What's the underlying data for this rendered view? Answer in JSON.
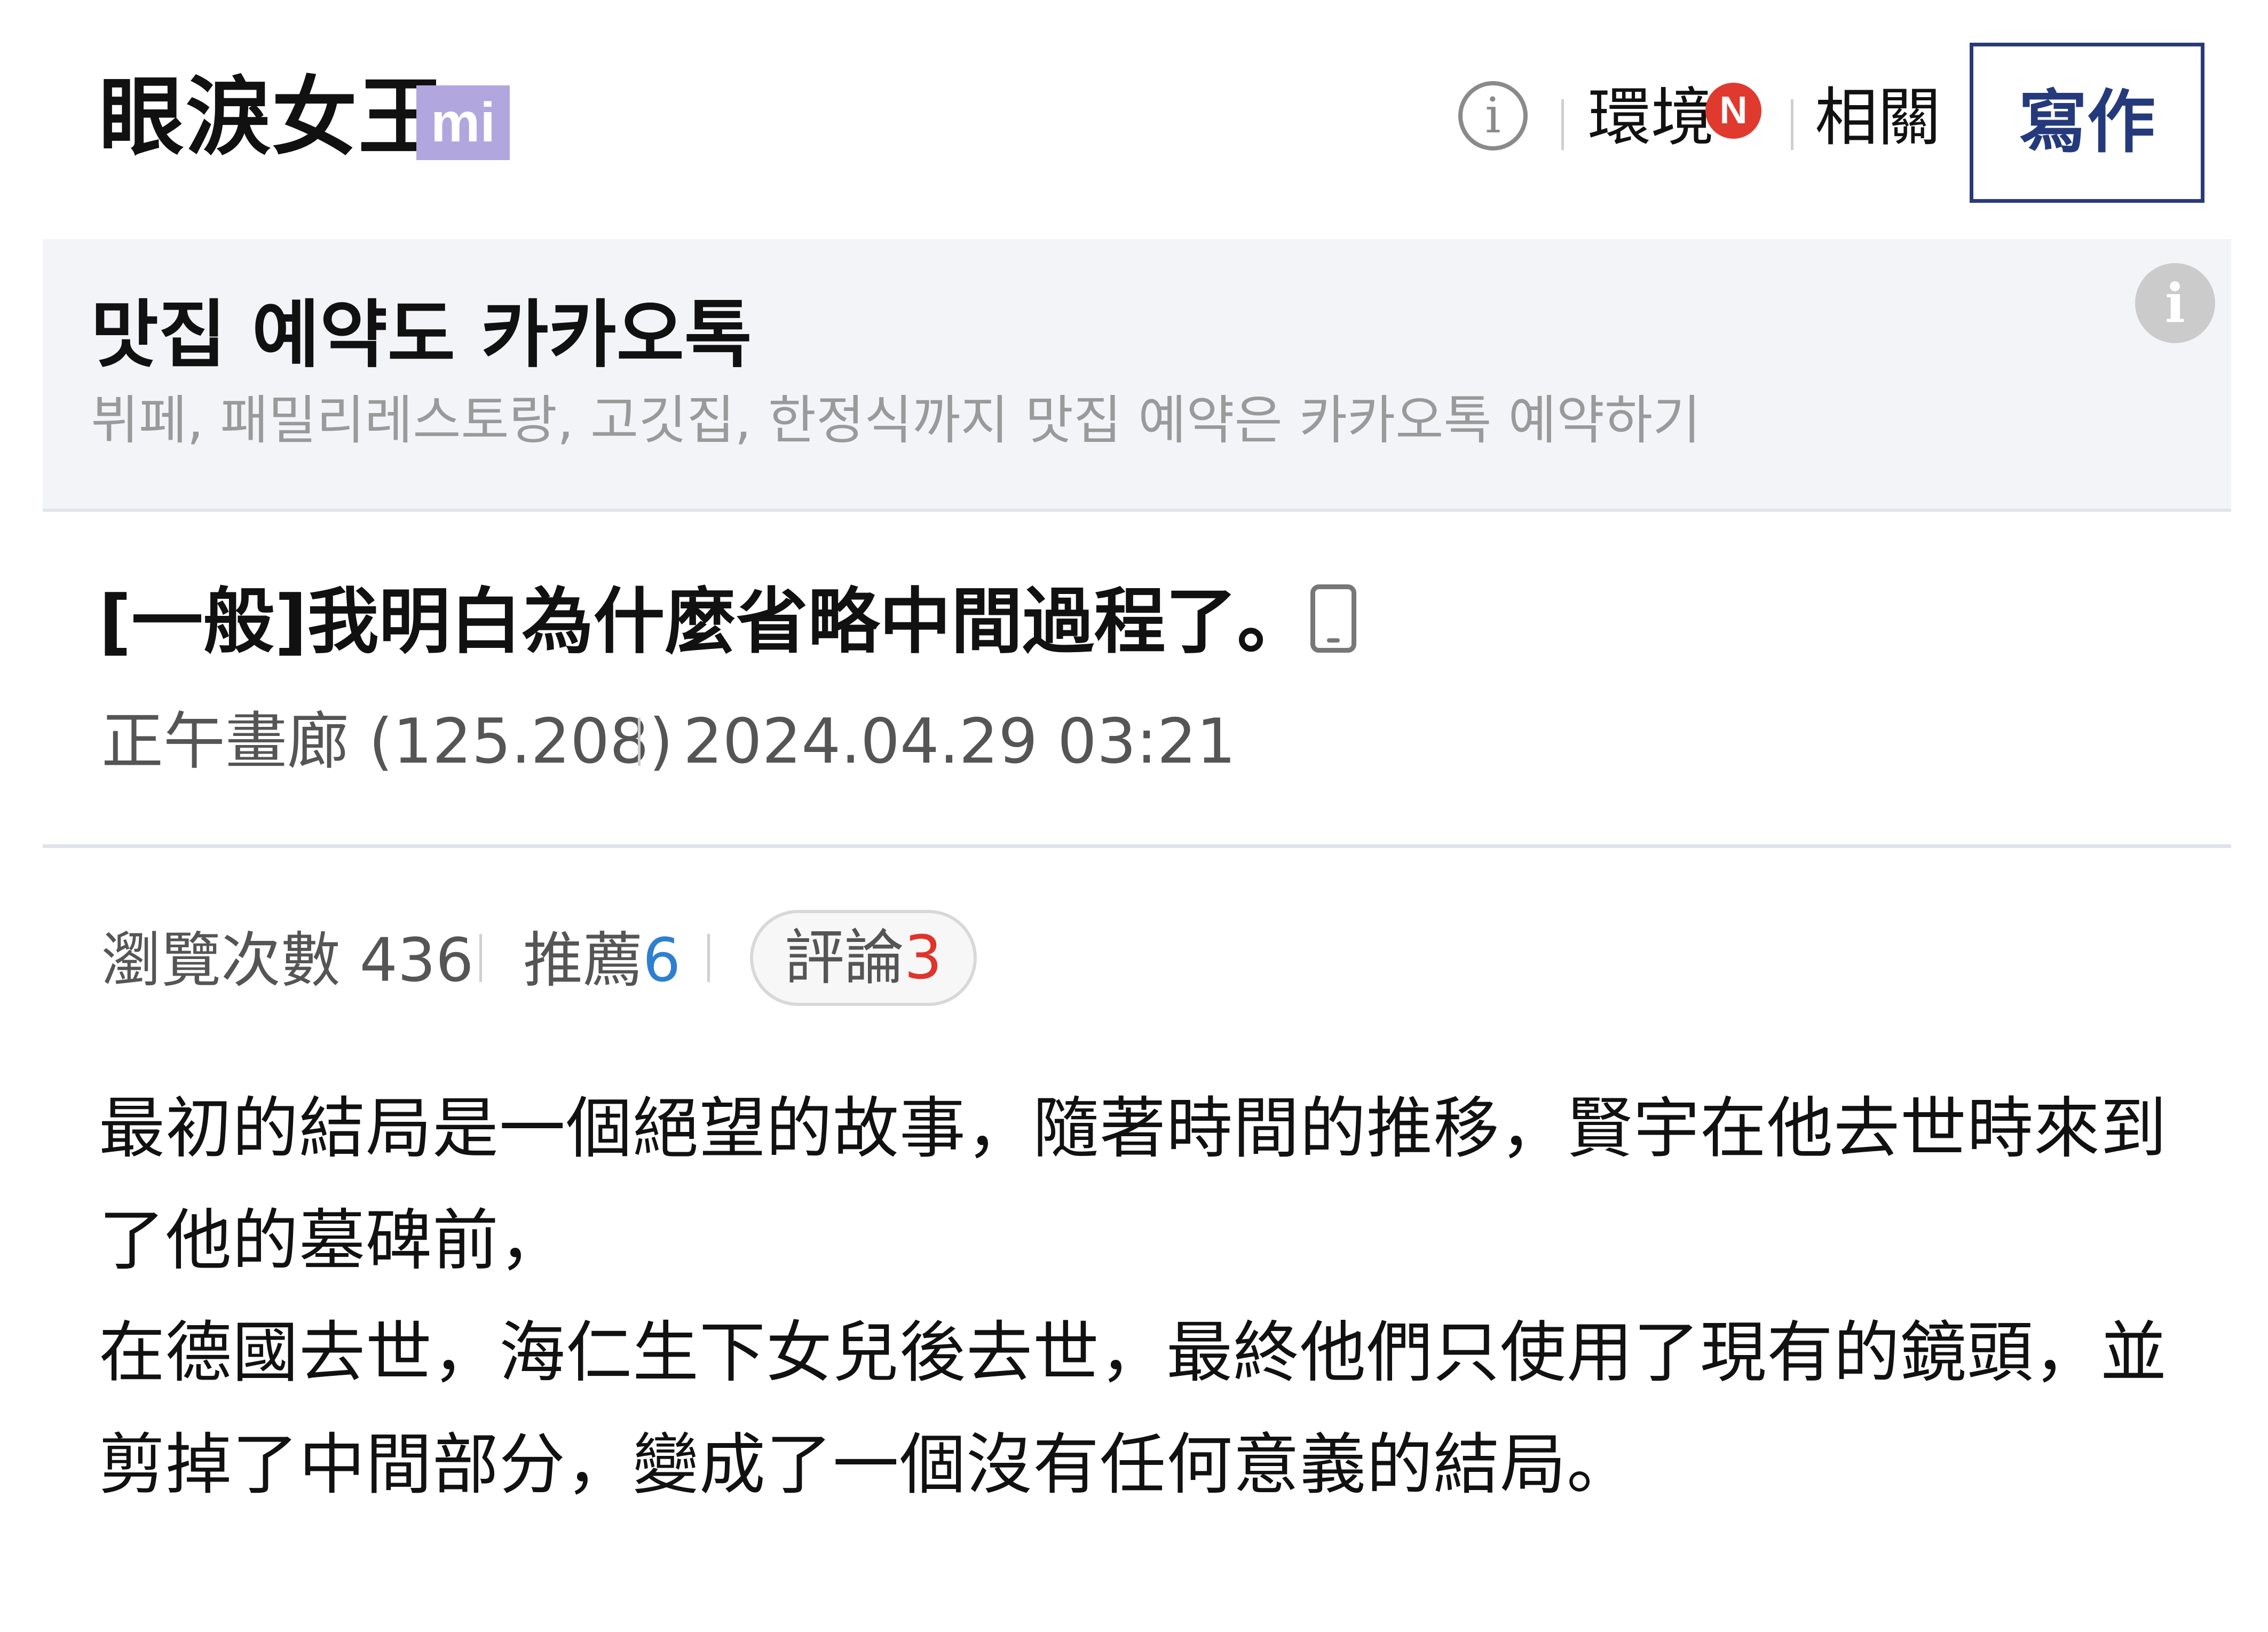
{
  "header": {
    "gallery_name": "眼淚女王",
    "badge": "mi",
    "environment_label": "環境",
    "environment_badge": "N",
    "related_label": "相關",
    "write_button": "寫作"
  },
  "ad": {
    "title": "맛집 예약도 카카오톡",
    "subtitle": "뷔페, 패밀리레스토랑, 고깃집, 한정식까지 맛집 예약은 카카오톡 예약하기"
  },
  "post": {
    "title": "[一般]我明白為什麼省略中間過程了。",
    "author": "正午畫廊 (125.208)",
    "datetime": "2024.04.29 03:21",
    "views_label": "瀏覽次數 436",
    "recommend_label": "推薦",
    "recommend_count": "6",
    "comments_label": "評論",
    "comments_count": "3",
    "body": [
      "最初的結局是一個絕望的故事，隨著時間的推移，賢宇在他去世時來到了他的墓碑前，",
      "在德國去世，海仁生下女兒後去世，最終他們只使用了現有的鏡頭，並剪掉了中間部分，變成了一個沒有任何意義的結局。"
    ]
  },
  "icons": {
    "info": "info-icon",
    "phone": "mobile-phone-icon"
  },
  "colors": {
    "badge_bg": "#b1a7de",
    "new_badge": "#e03a2f",
    "write_border": "#2a3a78",
    "recommend_count": "#2f7fd1",
    "comment_count": "#e0332b"
  }
}
